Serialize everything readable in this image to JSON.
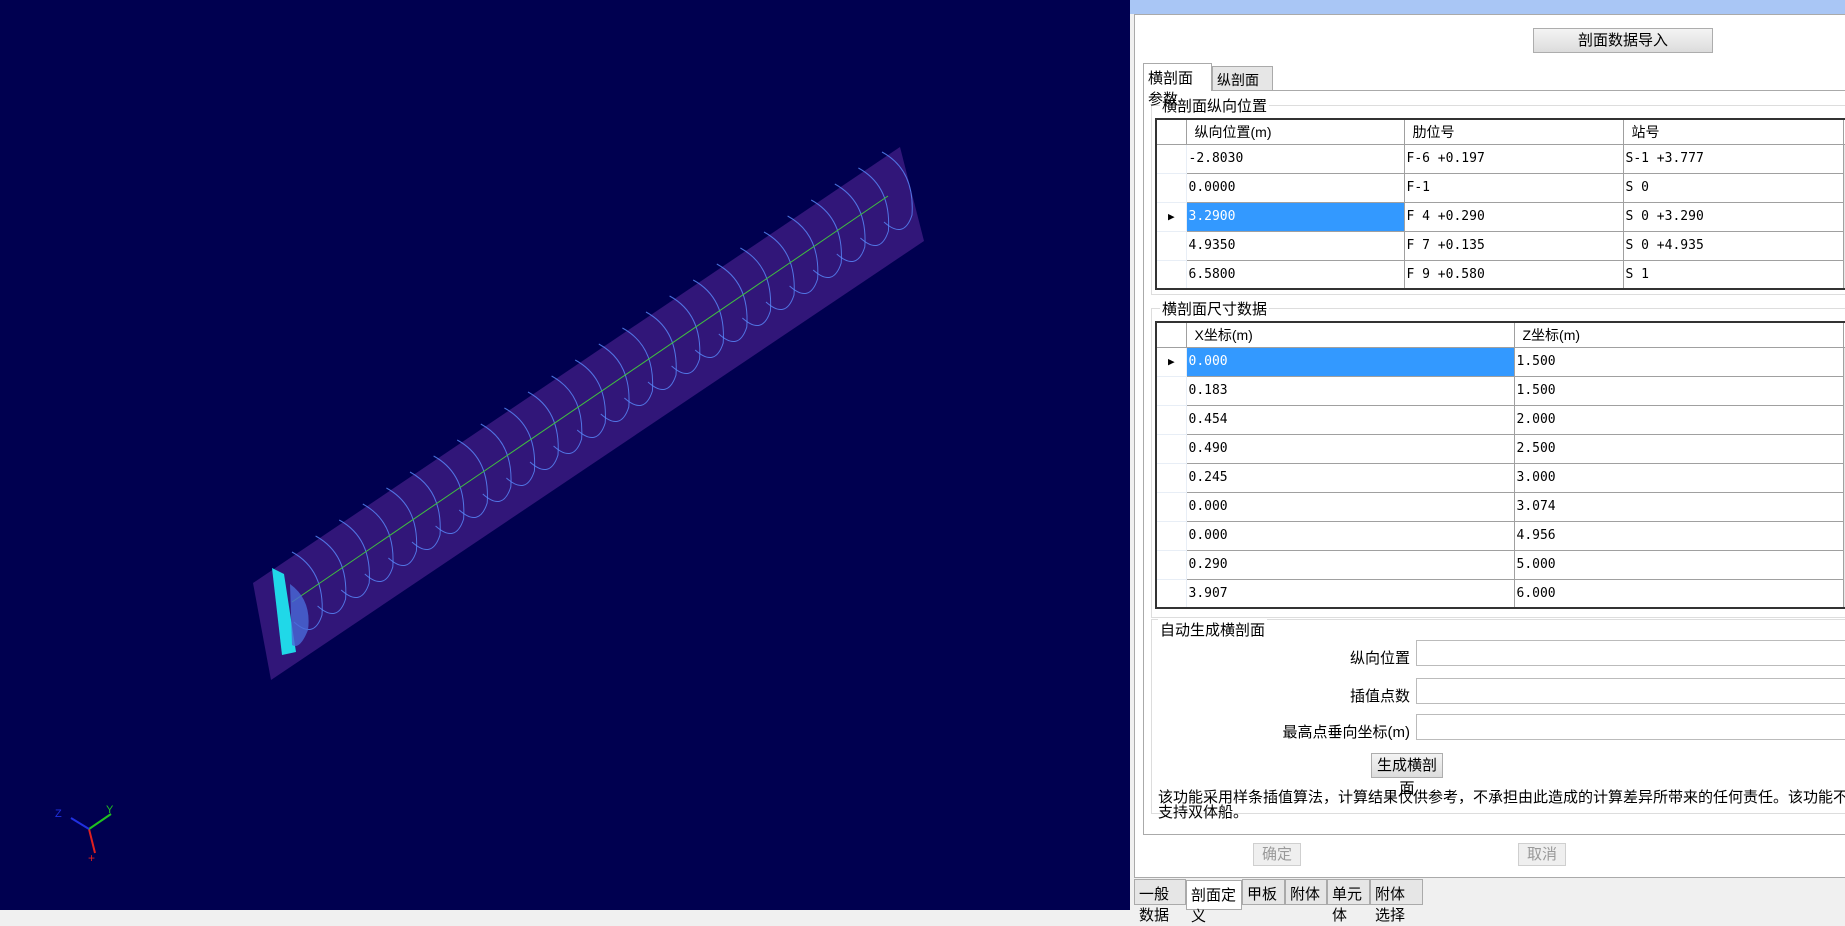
{
  "toolbar": {
    "import_label": "剖面数据导入"
  },
  "tabs": [
    {
      "label": "横剖面参数",
      "active": true
    },
    {
      "label": "纵剖面参数",
      "active": false
    }
  ],
  "group_positions": {
    "title": "横剖面纵向位置",
    "columns": [
      "纵向位置(m)",
      "肋位号",
      "站号"
    ],
    "rows": [
      [
        "-2.8030",
        "F-6 +0.197",
        "S-1 +3.777"
      ],
      [
        "0.0000",
        "F-1",
        "S 0"
      ],
      [
        "3.2900",
        "F 4 +0.290",
        "S 0 +3.290"
      ],
      [
        "4.9350",
        "F 7 +0.135",
        "S 0 +4.935"
      ],
      [
        "6.5800",
        "F 9 +0.580",
        "S 1"
      ]
    ],
    "selected_row": 2
  },
  "group_dimensions": {
    "title": "横剖面尺寸数据",
    "columns": [
      "X坐标(m)",
      "Z坐标(m)"
    ],
    "rows": [
      [
        "0.000",
        "1.500"
      ],
      [
        "0.183",
        "1.500"
      ],
      [
        "0.454",
        "2.000"
      ],
      [
        "0.490",
        "2.500"
      ],
      [
        "0.245",
        "3.000"
      ],
      [
        "0.000",
        "3.074"
      ],
      [
        "0.000",
        "4.956"
      ],
      [
        "0.290",
        "5.000"
      ],
      [
        "3.907",
        "6.000"
      ]
    ],
    "selected_row": 0
  },
  "auto_generate": {
    "title": "自动生成横剖面",
    "fields": [
      {
        "label": "纵向位置",
        "value": ""
      },
      {
        "label": "插值点数",
        "value": ""
      },
      {
        "label": "最高点垂向坐标(m)",
        "value": ""
      }
    ],
    "generate_label": "生成横剖面",
    "note": "该功能采用样条插值算法，计算结果仅供参考，不承担由此造成的计算差异所带来的任何责任。该功能不支持双体船。"
  },
  "footer": {
    "ok_label": "确定",
    "cancel_label": "取消"
  },
  "bottom_tabs": [
    {
      "label": "一般数据",
      "active": false
    },
    {
      "label": "剖面定义",
      "active": true
    },
    {
      "label": "甲板",
      "active": false
    },
    {
      "label": "附体",
      "active": false
    },
    {
      "label": "单元体",
      "active": false
    },
    {
      "label": "附体选择",
      "active": false
    }
  ],
  "colors": {
    "viewport_bg": "#000050",
    "hull": "#3a1a80",
    "rib": "#5a8cff",
    "centerline": "#40c040",
    "section": "#20d8e8",
    "selection": "#3399ff"
  }
}
